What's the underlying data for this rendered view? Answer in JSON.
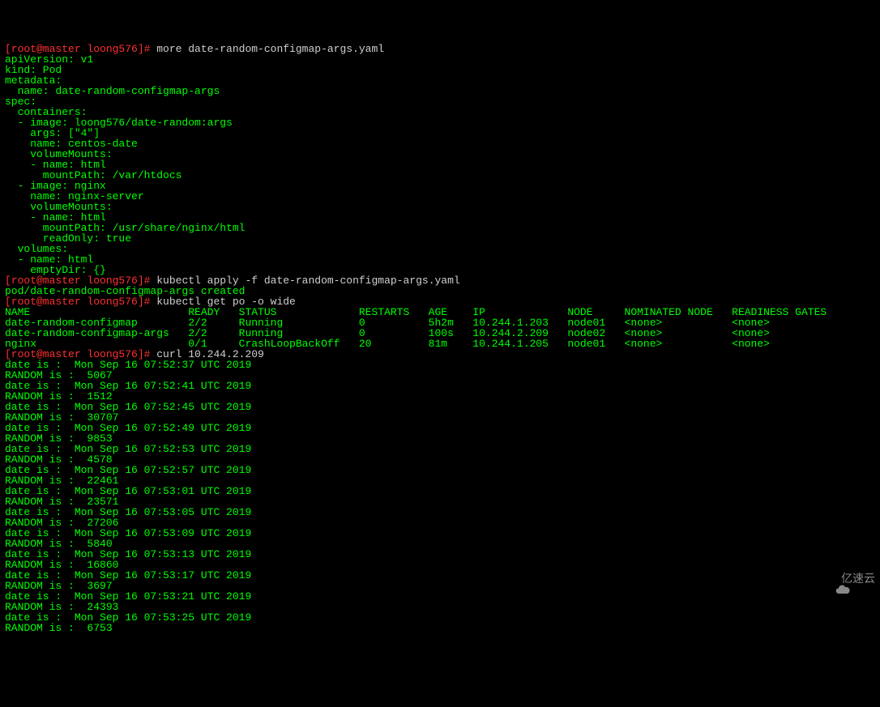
{
  "prompt_host": "[root@master loong576]# ",
  "cmd1": "more date-random-configmap-args.yaml",
  "yaml": [
    "apiVersion: v1",
    "kind: Pod",
    "metadata:",
    "  name: date-random-configmap-args",
    "spec:",
    "  containers:",
    "  - image: loong576/date-random:args",
    "    args: [\"4\"]",
    "    name: centos-date",
    "    volumeMounts:",
    "    - name: html",
    "      mountPath: /var/htdocs",
    "  - image: nginx",
    "    name: nginx-server",
    "    volumeMounts:",
    "    - name: html",
    "      mountPath: /usr/share/nginx/html",
    "      readOnly: true",
    "  volumes:",
    "  - name: html",
    "    emptyDir: {}"
  ],
  "cmd2": "kubectl apply -f date-random-configmap-args.yaml",
  "apply_output": "pod/date-random-configmap-args created",
  "cmd3": "kubectl get po -o wide",
  "table_header": "NAME                         READY   STATUS             RESTARTS   AGE    IP             NODE     NOMINATED NODE   READINESS GATES",
  "table_rows": [
    "date-random-configmap        2/2     Running            0          5h2m   10.244.1.203   node01   <none>           <none>",
    "date-random-configmap-args   2/2     Running            0          100s   10.244.2.209   node02   <none>           <none>",
    "nginx                        0/1     CrashLoopBackOff   20         81m    10.244.1.205   node01   <none>           <none>"
  ],
  "cmd4": "curl 10.244.2.209",
  "curl_output": [
    "date is :  Mon Sep 16 07:52:37 UTC 2019",
    "RANDOM is :  5067",
    "date is :  Mon Sep 16 07:52:41 UTC 2019",
    "RANDOM is :  1512",
    "date is :  Mon Sep 16 07:52:45 UTC 2019",
    "RANDOM is :  30707",
    "date is :  Mon Sep 16 07:52:49 UTC 2019",
    "RANDOM is :  9853",
    "date is :  Mon Sep 16 07:52:53 UTC 2019",
    "RANDOM is :  4578",
    "date is :  Mon Sep 16 07:52:57 UTC 2019",
    "RANDOM is :  22461",
    "date is :  Mon Sep 16 07:53:01 UTC 2019",
    "RANDOM is :  23571",
    "date is :  Mon Sep 16 07:53:05 UTC 2019",
    "RANDOM is :  27206",
    "date is :  Mon Sep 16 07:53:09 UTC 2019",
    "RANDOM is :  5840",
    "date is :  Mon Sep 16 07:53:13 UTC 2019",
    "RANDOM is :  16860",
    "date is :  Mon Sep 16 07:53:17 UTC 2019",
    "RANDOM is :  3697",
    "date is :  Mon Sep 16 07:53:21 UTC 2019",
    "RANDOM is :  24393",
    "date is :  Mon Sep 16 07:53:25 UTC 2019",
    "RANDOM is :  6753"
  ],
  "watermark_text": "亿速云"
}
